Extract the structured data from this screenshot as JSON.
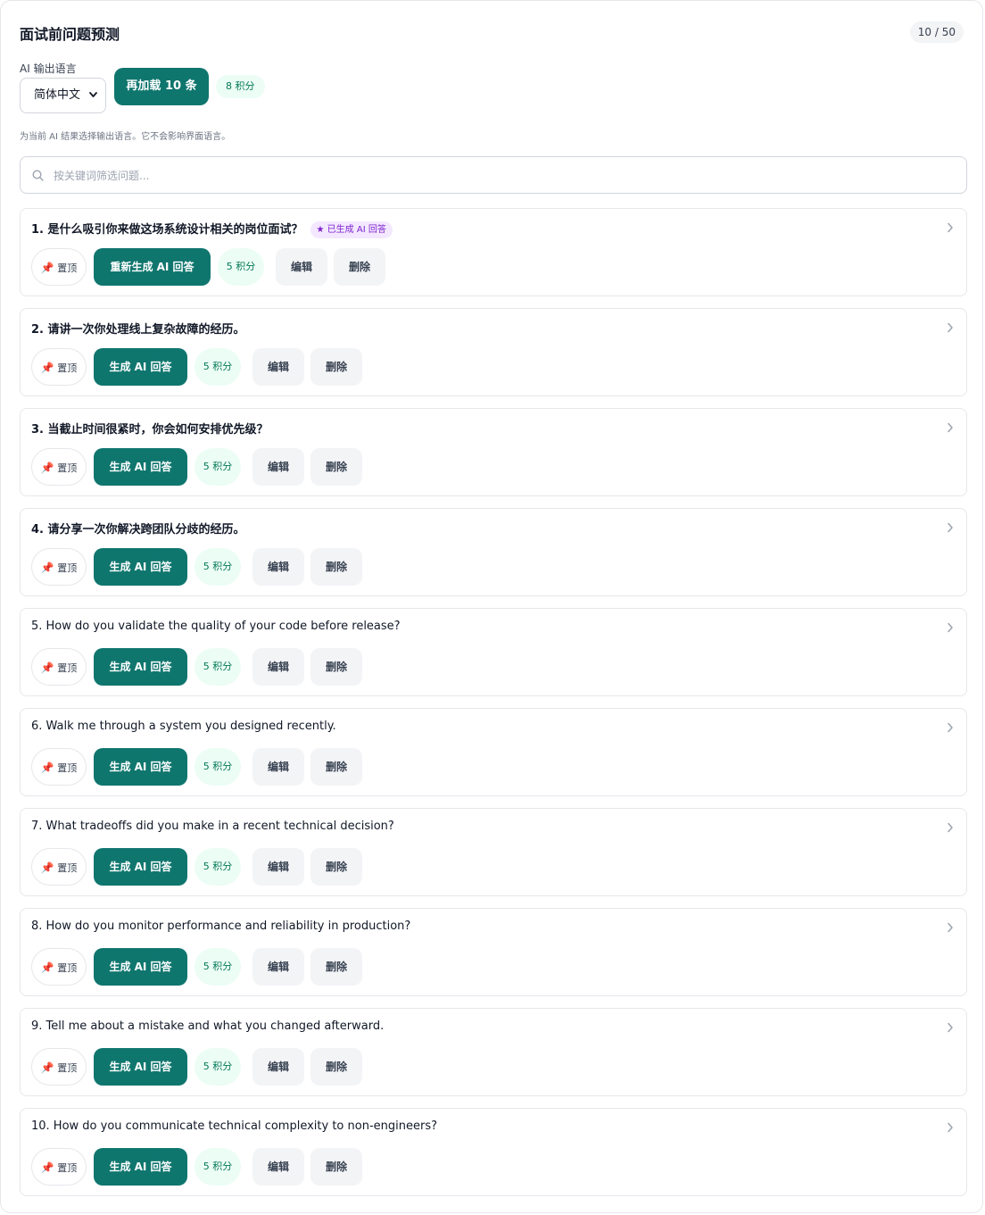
{
  "header": {
    "title": "面试前问题预测",
    "count": "10 / 50"
  },
  "language": {
    "label": "AI 输出语言",
    "selected": "简体中文",
    "hint": "为当前 AI 结果选择输出语言。它不会影响界面语言。"
  },
  "load_more": {
    "label": "再加载 10 条",
    "cost": "8 积分"
  },
  "search": {
    "placeholder": "按关键词筛选问题..."
  },
  "actions": {
    "pin": "置顶",
    "generate": "生成 AI 回答",
    "regenerate": "重新生成 AI 回答",
    "cost": "5 积分",
    "edit": "编辑",
    "delete": "删除"
  },
  "ai_badge": "已生成 AI 回答",
  "questions": [
    {
      "text": "1. 是什么吸引你来做这场系统设计相关的岗位面试？",
      "generated": true
    },
    {
      "text": "2. 请讲一次你处理线上复杂故障的经历。",
      "generated": false
    },
    {
      "text": "3. 当截止时间很紧时，你会如何安排优先级？",
      "generated": false
    },
    {
      "text": "4. 请分享一次你解决跨团队分歧的经历。",
      "generated": false
    },
    {
      "text": "5. How do you validate the quality of your code before release?",
      "generated": false
    },
    {
      "text": "6. Walk me through a system you designed recently.",
      "generated": false
    },
    {
      "text": "7. What tradeoffs did you make in a recent technical decision?",
      "generated": false
    },
    {
      "text": "8. How do you monitor performance and reliability in production?",
      "generated": false
    },
    {
      "text": "9. Tell me about a mistake and what you changed afterward.",
      "generated": false
    },
    {
      "text": "10. How do you communicate technical complexity to non-engineers?",
      "generated": false
    }
  ],
  "colors": {
    "primary": "#0f766e",
    "credit_bg": "#ecfdf5",
    "credit_text": "#047857",
    "ai_badge_bg": "#f3e8ff",
    "ai_badge_text": "#7e22ce"
  }
}
